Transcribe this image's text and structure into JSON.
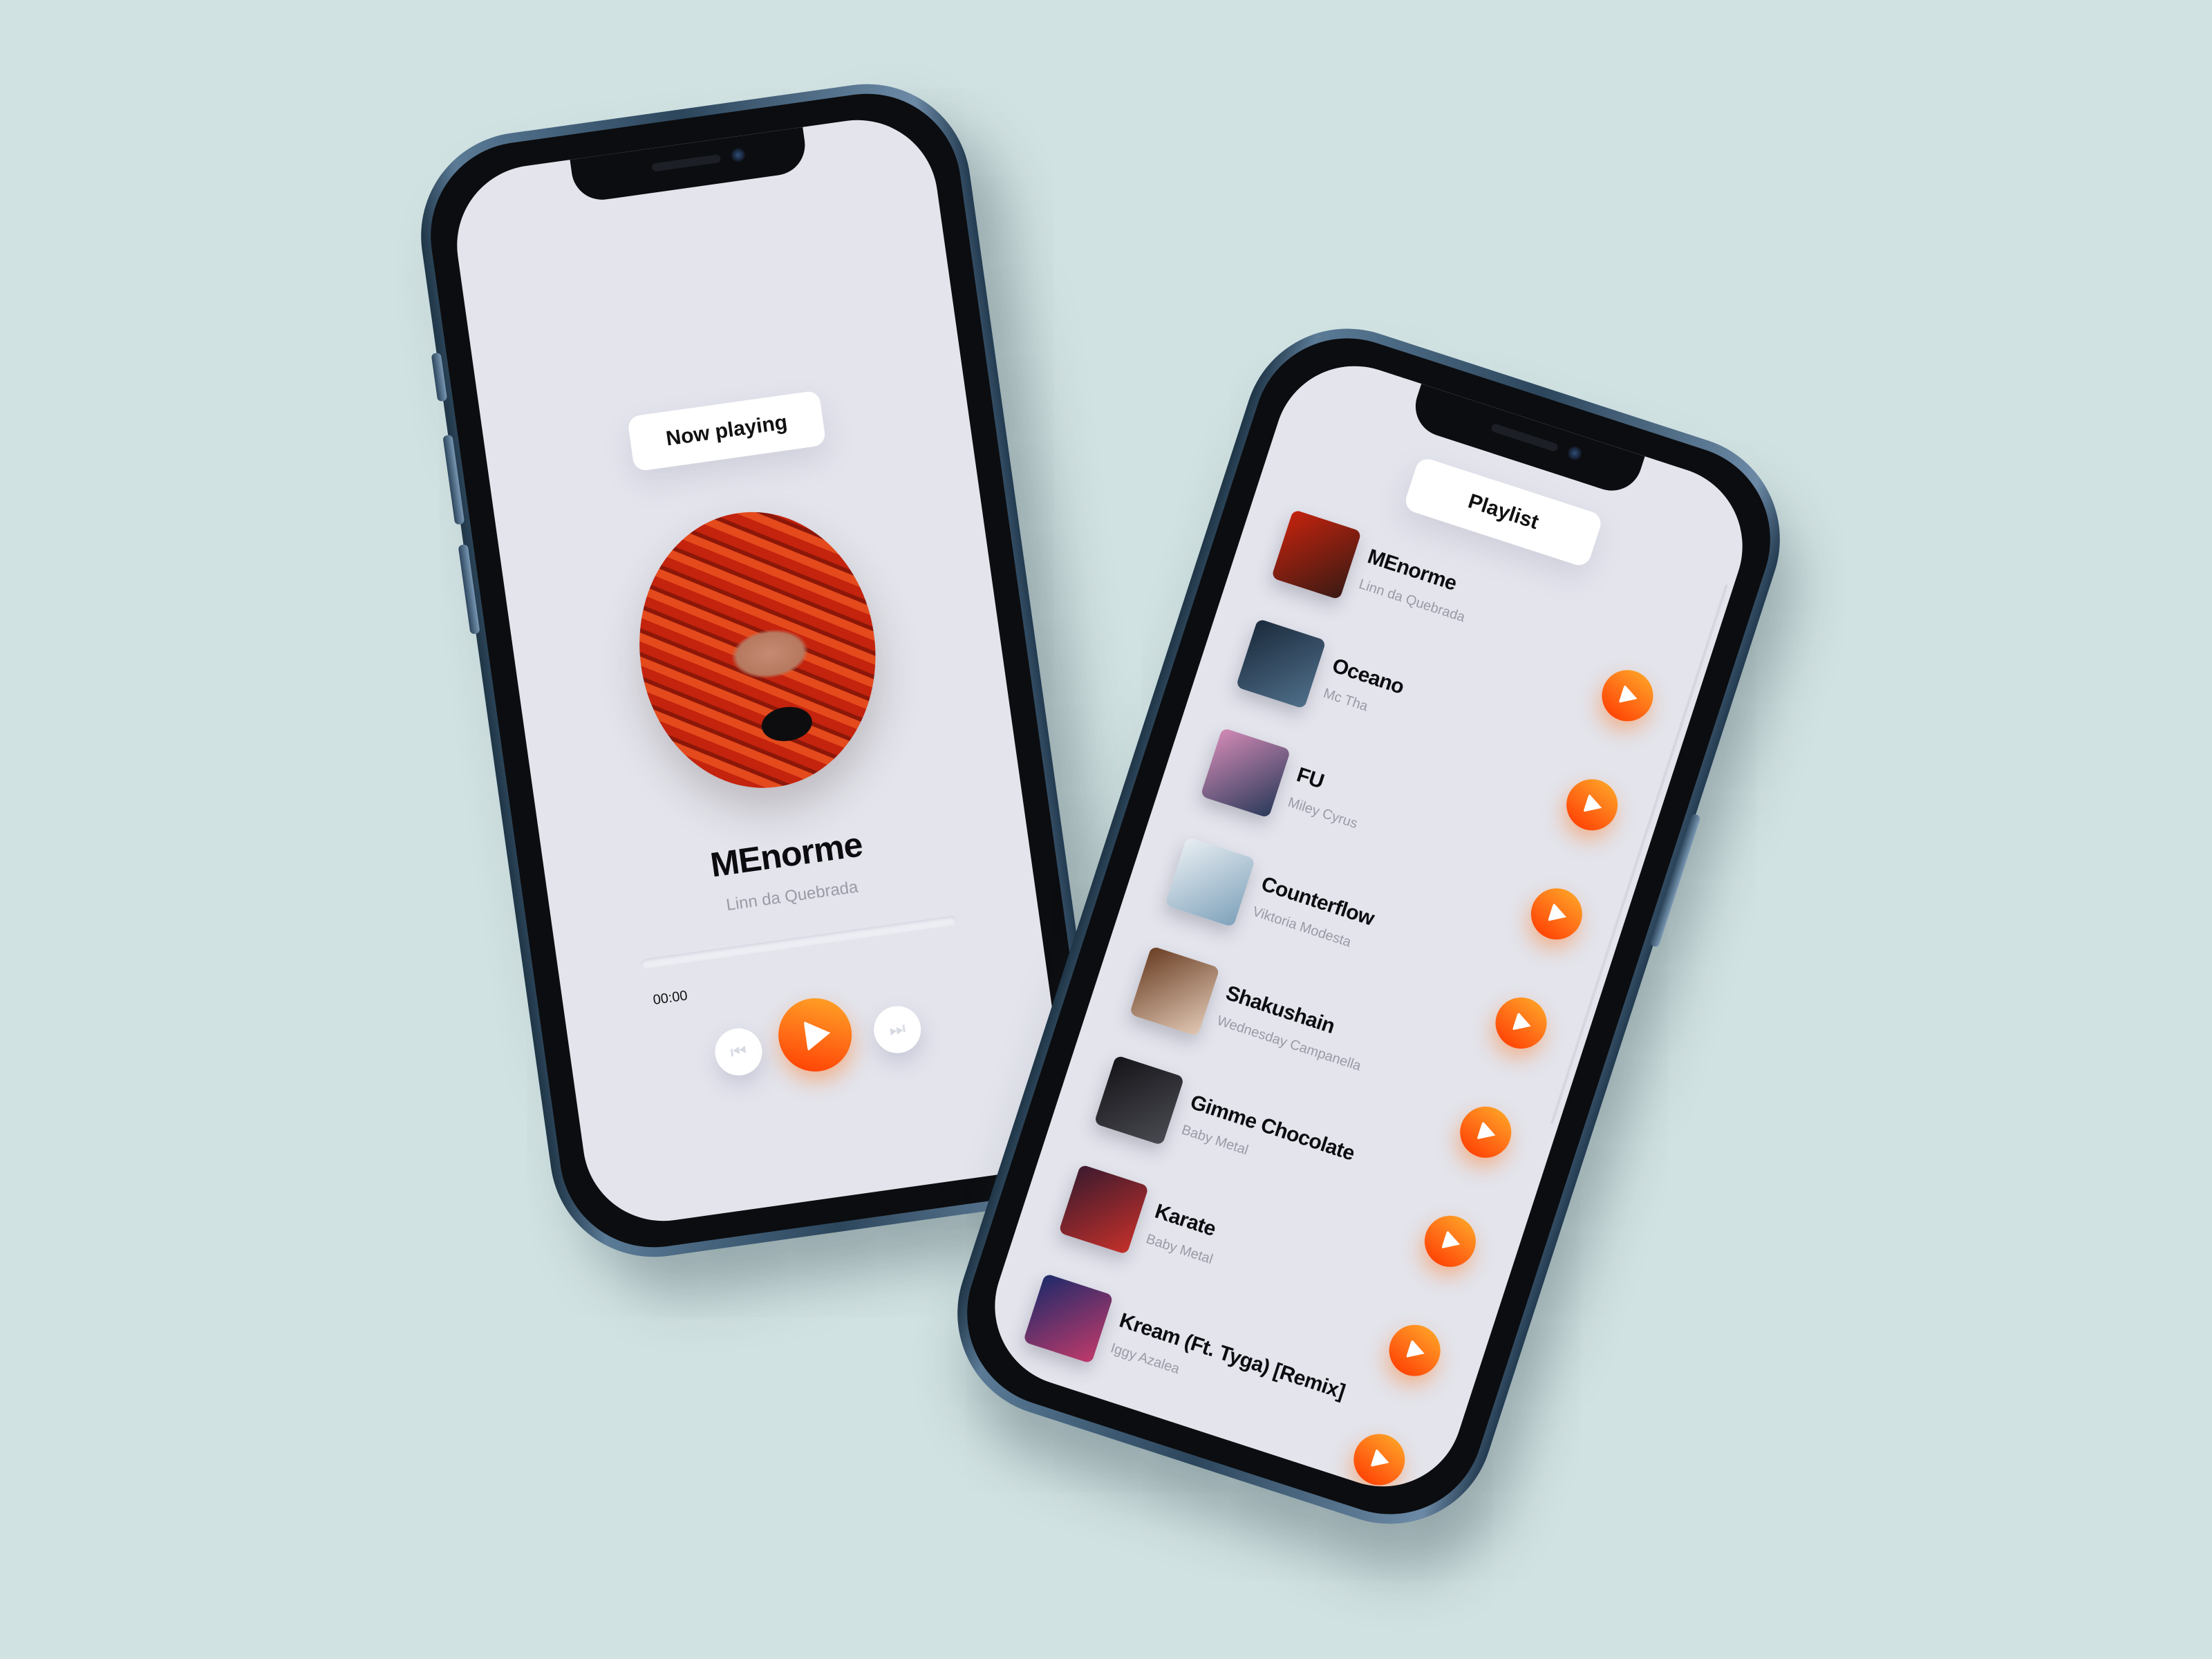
{
  "now_playing": {
    "header": "Now playing",
    "track": {
      "title": "MEnorme",
      "artist": "Linn da Quebrada"
    },
    "elapsed": "00:00",
    "progress": 0
  },
  "playlist": {
    "header": "Playlist",
    "items": [
      {
        "title": "MEnorme",
        "artist": "Linn da Quebrada",
        "thumb_colors": [
          "#c4230d",
          "#3a1a14"
        ]
      },
      {
        "title": "Oceano",
        "artist": "Mc Tha",
        "thumb_colors": [
          "#1b2a3c",
          "#4f6f8a"
        ]
      },
      {
        "title": "FU",
        "artist": "Miley Cyrus",
        "thumb_colors": [
          "#d28ab5",
          "#2a3a5a"
        ]
      },
      {
        "title": "Counterflow",
        "artist": "Viktoria Modesta",
        "thumb_colors": [
          "#e8eef2",
          "#7fa2bb"
        ]
      },
      {
        "title": "Shakushain",
        "artist": "Wednesday Campanella",
        "thumb_colors": [
          "#6a3e24",
          "#e1c8b4"
        ]
      },
      {
        "title": "Gimme Chocolate",
        "artist": "Baby Metal",
        "thumb_colors": [
          "#141418",
          "#4a4a52"
        ]
      },
      {
        "title": "Karate",
        "artist": "Baby Metal",
        "thumb_colors": [
          "#3b1a2e",
          "#c4302a"
        ]
      },
      {
        "title": "Kream (Ft. Tyga) [Remix]",
        "artist": "Iggy Azalea",
        "thumb_colors": [
          "#1e2a6a",
          "#c03a6a"
        ]
      }
    ]
  },
  "colors": {
    "accent": "#ff6c16",
    "background": "#d1e2e2",
    "screen": "#e3e4ec"
  }
}
